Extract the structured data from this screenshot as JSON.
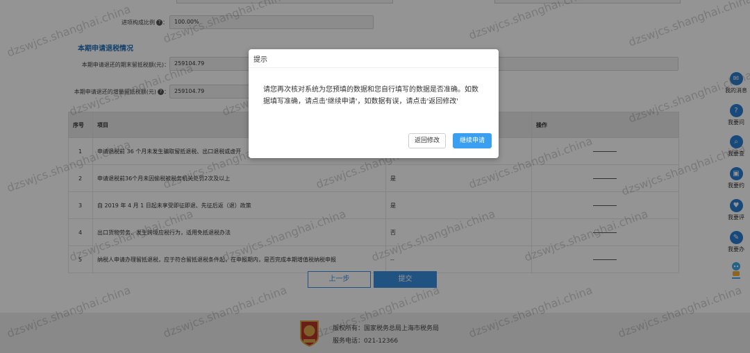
{
  "form": {
    "input_ratio_label": "进项构成比例",
    "input_ratio_value": "100.00%",
    "section_title": "本期申请退税情况",
    "refund_end_label": "本期申请退还的期末留抵税额(元)：",
    "refund_end_value": "259104.79",
    "refund_incr_label": "本期申请退还的增量留抵税额(元)",
    "refund_incr_value": "259104.79"
  },
  "table": {
    "headers": [
      "序号",
      "项目",
      "",
      "操作"
    ],
    "rows": [
      {
        "no": "1",
        "item": "申请退税前 36 个月未发生骗取留抵退税、出口退税或虚开",
        "value": "",
        "op": "———"
      },
      {
        "no": "2",
        "item": "申请退税前36个月未因偷税被税务机关处罚2次及以上",
        "value": "是",
        "op": "———"
      },
      {
        "no": "3",
        "item": "自 2019 年 4 月 1 日起未享受即征即退、先征后返（退）政策",
        "value": "是",
        "op": "———"
      },
      {
        "no": "4",
        "item": "出口货物劳务、发生跨境应税行为，适用免抵退税办法",
        "value": "否",
        "op": "———"
      },
      {
        "no": "5",
        "item": "纳税人申请办理留抵退税，应于符合留抵退税条件起，在申报期内，是否完成本期增值税纳税申报",
        "value": "--",
        "op": "———"
      }
    ]
  },
  "buttons": {
    "prev": "上一步",
    "submit": "提交"
  },
  "footer": {
    "copyright": "版权所有：国家税务总局上海市税务局",
    "phone": "服务电话：021-12366"
  },
  "sidebar": [
    {
      "label": "我的消息",
      "icon": "message-icon"
    },
    {
      "label": "我要问",
      "icon": "question-icon"
    },
    {
      "label": "我要查",
      "icon": "search-icon"
    },
    {
      "label": "我要约",
      "icon": "calendar-icon"
    },
    {
      "label": "我要评",
      "icon": "review-icon"
    },
    {
      "label": "我要办",
      "icon": "edit-icon"
    }
  ],
  "watermark": "dzswjcs.shanghai.china",
  "modal": {
    "title": "提示",
    "message": "请您再次核对系统为您预填的数据和您自行填写的数据是否准确。如数据填写准确，请点击'继续申请'，如数据有误，请点击'返回修改'",
    "back_label": "返回修改",
    "continue_label": "继续申请"
  },
  "colors": {
    "accent": "#3a8fe0",
    "section_title": "#1f6fb8",
    "sidebar_icon": "#2a7fd4"
  }
}
